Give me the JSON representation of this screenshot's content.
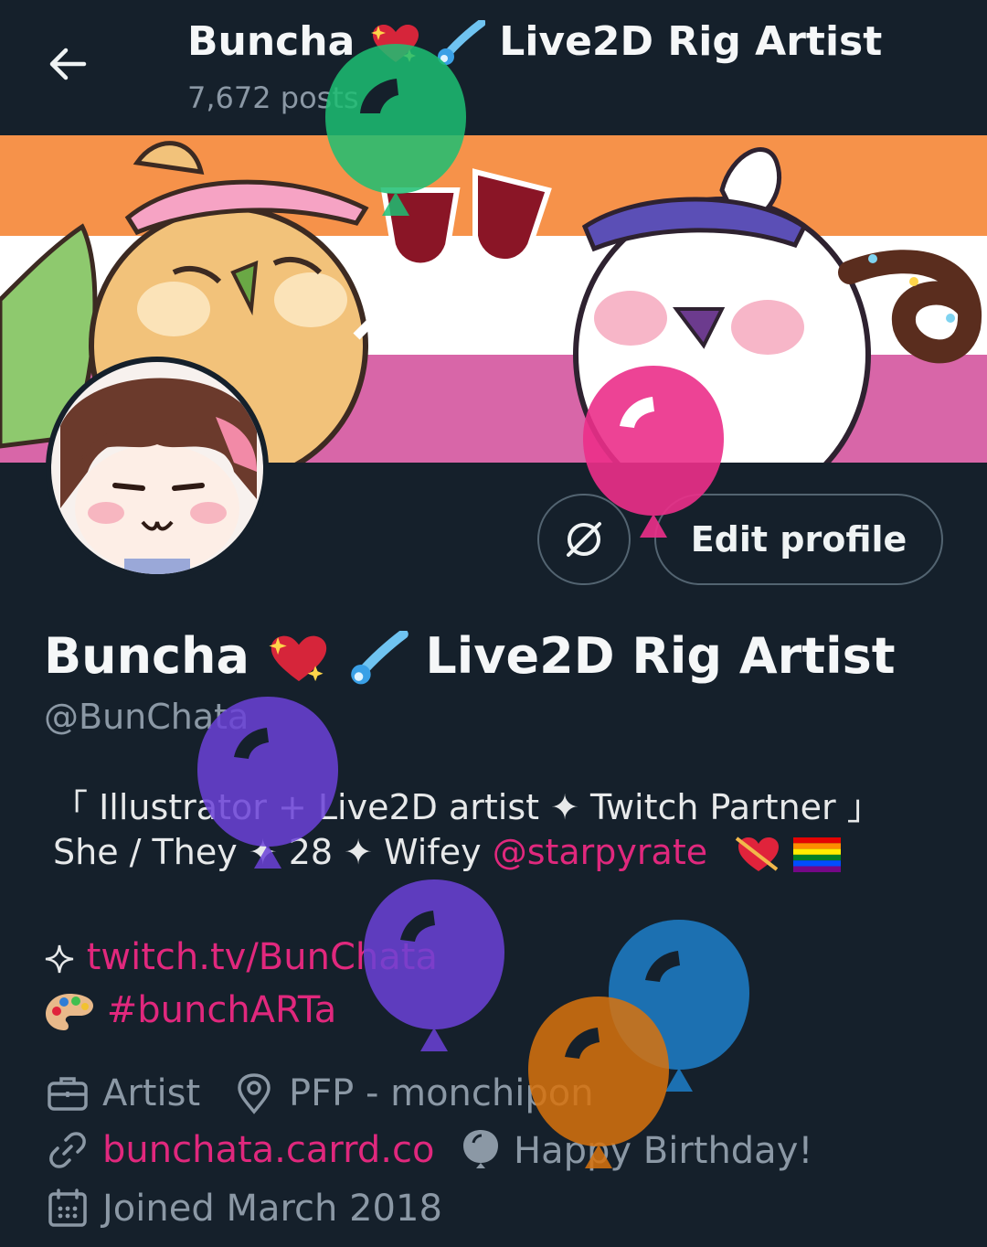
{
  "header": {
    "display_name": "Buncha",
    "title_suffix": "Live2D Rig Artist",
    "posts": "7,672 posts"
  },
  "profile": {
    "display_name": "Buncha",
    "title_suffix": "Live2D Rig Artist",
    "handle": "@BunChata",
    "bio_line1": "「 Illustrator + Live2D artist ✦ Twitch Partner 」",
    "bio_line2_prefix": "She / They ✦ 28 ✦ Wifey ",
    "bio_mention": "@starpyrate",
    "link1": "twitch.tv/BunChata",
    "link2": "#bunchARTa",
    "category": "Artist",
    "location": "PFP - monchipon",
    "website": "bunchata.carrd.co",
    "birthday": "Happy Birthday!",
    "joined": "Joined March 2018"
  },
  "buttons": {
    "edit_profile": "Edit profile"
  },
  "icons": {
    "back": "arrow-left-icon",
    "unlink": "no-symbol-icon",
    "category": "briefcase-icon",
    "location": "location-pin-icon",
    "website": "link-icon",
    "birthday": "balloon-icon",
    "joined": "calendar-icon"
  },
  "colors": {
    "background": "#15202b",
    "accent_pink": "#e0287d",
    "muted": "#8b98a5",
    "border": "#536471",
    "balloon_green": "#1dbf73",
    "balloon_pink": "#ec2f8a",
    "balloon_purple": "#6b42d8",
    "balloon_blue": "#1d7cc4",
    "balloon_orange": "#d9730d"
  }
}
